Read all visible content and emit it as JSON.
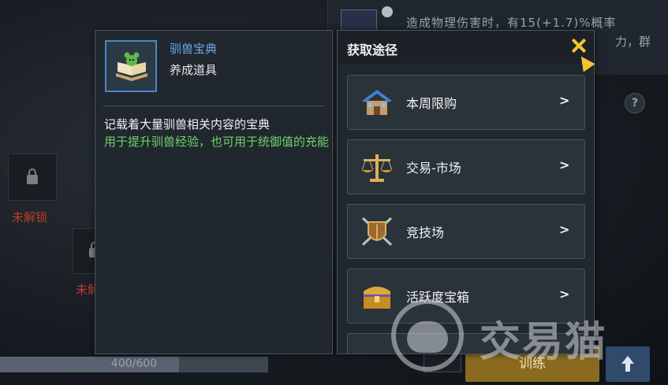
{
  "background": {
    "top_text_line1": "造成物理伤害时，有15(+1.7)%概率",
    "top_text_line2": "力，群",
    "locked_label_1": "未解锁",
    "locked_label_2": "未解",
    "progress_text": "400/600",
    "progress_fraction": 0.667,
    "train_button": "训练",
    "help_icon": "?"
  },
  "item": {
    "name": "驯兽宝典",
    "type": "养成道具",
    "description": "记载着大量驯兽相关内容的宝典",
    "usage": "用于提升驯兽经验，也可用于统御值的充能",
    "icon": "book-icon"
  },
  "source": {
    "title": "获取途径",
    "items": [
      {
        "label": "本周限购",
        "icon": "house-icon"
      },
      {
        "label": "交易-市场",
        "icon": "scales-icon"
      },
      {
        "label": "竞技场",
        "icon": "shield-swords-icon"
      },
      {
        "label": "活跃度宝箱",
        "icon": "treasure-chest-icon"
      }
    ],
    "chevron": ">"
  },
  "watermark": {
    "text": "交易猫"
  },
  "colors": {
    "accent_gold": "#f4c531",
    "item_name_blue": "#6fa6e8",
    "usage_green": "#6dd36a",
    "locked_red": "#c23a2a"
  }
}
